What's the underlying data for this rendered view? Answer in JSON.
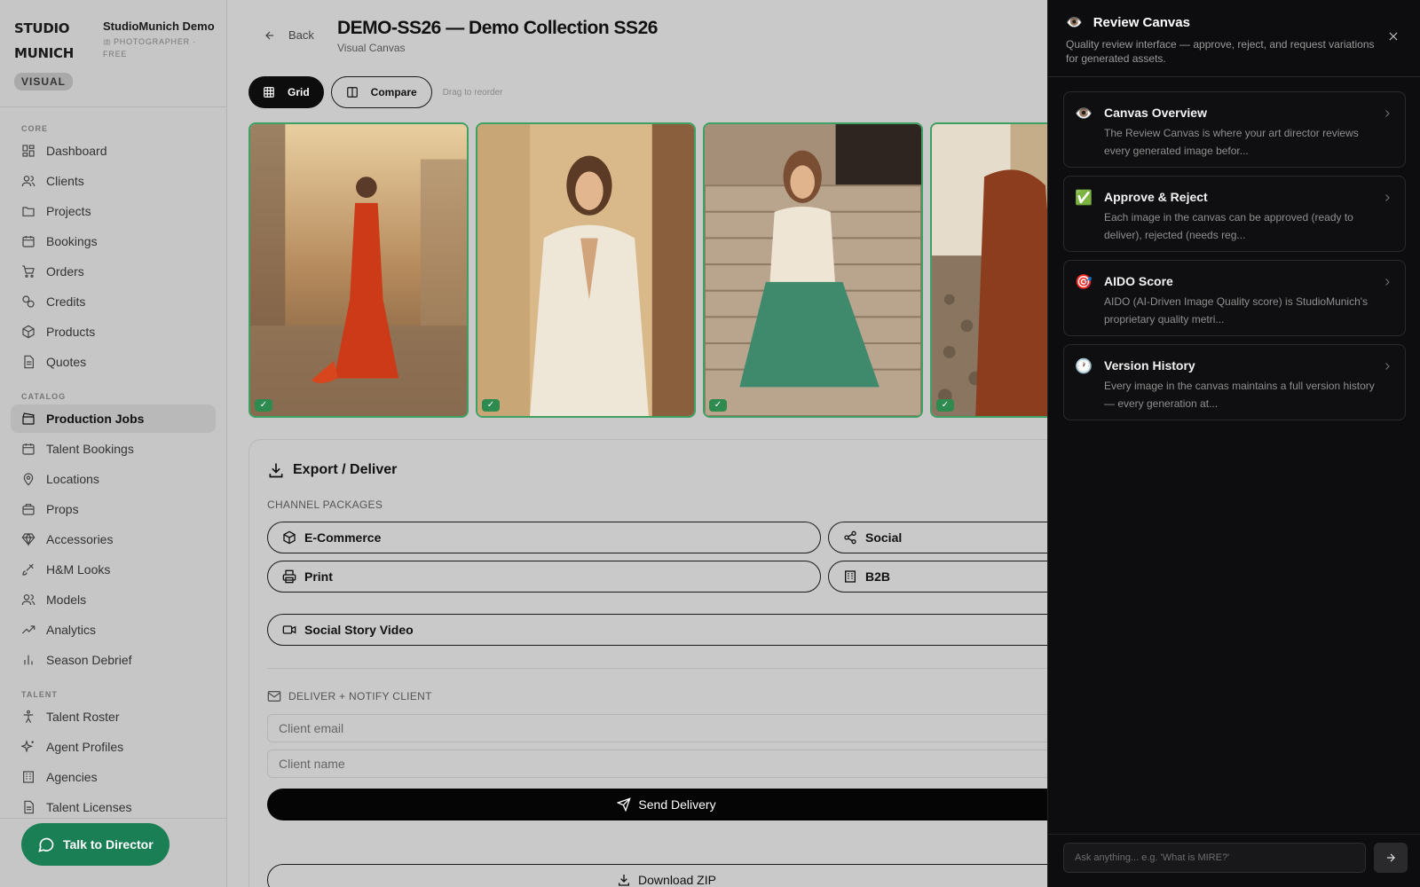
{
  "brand": {
    "logo": "STUDIO MUNICH",
    "tag": "VISUAL"
  },
  "org": {
    "name": "StudioMunich Demo",
    "role": "PHOTOGRAPHER · FREE"
  },
  "nav": {
    "core_label": "CORE",
    "core": [
      "Dashboard",
      "Clients",
      "Projects",
      "Bookings",
      "Orders",
      "Credits",
      "Products",
      "Quotes"
    ],
    "catalog_label": "CATALOG",
    "catalog": [
      "Production Jobs",
      "Talent Bookings",
      "Locations",
      "Props",
      "Accessories",
      "H&M Looks",
      "Models",
      "Analytics",
      "Season Debrief"
    ],
    "talent_label": "TALENT",
    "talent": [
      "Talent Roster",
      "Agent Profiles",
      "Agencies",
      "Talent Licenses"
    ],
    "active": "Production Jobs"
  },
  "talk_button": "Talk to Director",
  "header": {
    "back": "Back",
    "title": "DEMO-SS26 — Demo Collection SS26",
    "subtitle": "Visual Canvas"
  },
  "toolbar": {
    "grid": "Grid",
    "compare": "Compare",
    "hint": "Drag to reorder"
  },
  "thumbnails": [
    {
      "status": "approved",
      "check": "✓"
    },
    {
      "status": "approved",
      "check": "✓"
    },
    {
      "status": "approved",
      "check": "✓"
    },
    {
      "status": "approved",
      "check": "✓"
    }
  ],
  "export": {
    "title": "Export / Deliver",
    "channel_label": "CHANNEL PACKAGES",
    "channels": [
      "E-Commerce",
      "Social",
      "Print",
      "B2B"
    ],
    "video": "Social Story Video",
    "notify_label": "DELIVER + NOTIFY CLIENT",
    "email_placeholder": "Client email",
    "name_placeholder": "Client name",
    "send": "Send Delivery",
    "zip": "Download ZIP"
  },
  "panel": {
    "emoji": "👁️",
    "title": "Review Canvas",
    "description": "Quality review interface — approve, reject, and request variations for generated assets.",
    "cards": [
      {
        "icon": "👁️",
        "title": "Canvas Overview",
        "text": "The Review Canvas is where your art director reviews every generated image befor..."
      },
      {
        "icon": "✅",
        "title": "Approve & Reject",
        "text": "Each image in the canvas can be approved (ready to deliver), rejected (needs reg..."
      },
      {
        "icon": "🎯",
        "title": "AIDO Score",
        "text": "AIDO (AI-Driven Image Quality score) is StudioMunich's proprietary quality metri..."
      },
      {
        "icon": "🕐",
        "title": "Version History",
        "text": "Every image in the canvas maintains a full version history — every generation at..."
      }
    ],
    "ask_placeholder": "Ask anything... e.g. 'What is MIRE?'"
  },
  "colors": {
    "approved_border": "#3ea062",
    "talk_button": "#1b7f55",
    "panel_bg": "#0d0d0f"
  }
}
